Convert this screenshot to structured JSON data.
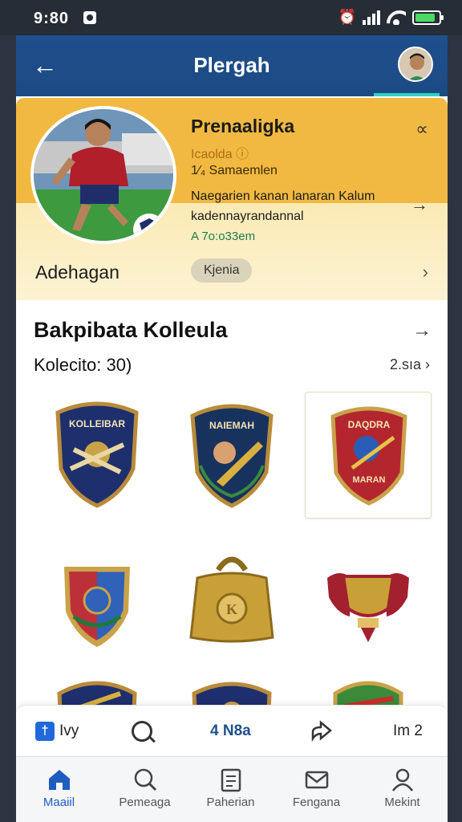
{
  "status_bar": {
    "time": "9:80",
    "battery_level": 0.85
  },
  "header": {
    "title": "Plergah",
    "back_icon": "arrow-left-icon",
    "avatar_icon": "user-avatar-icon"
  },
  "profile": {
    "name": "Prenaaligka",
    "club": "Icaolda ⓘ",
    "rank": "1⁄₄ Samaemlen",
    "description": "Naegarien kanan lanaran Kalum kadennayrandannal",
    "points": "A 7o:o33em",
    "label": "Adehagan",
    "chip": "Kjenia"
  },
  "collection": {
    "title": "Bakpibata Kolleula",
    "count": "Kolecito: 30)",
    "more": "2.sıa"
  },
  "badges": [
    {
      "type": "shield",
      "top_text": "KOLLEIBAR",
      "bottom_text": "",
      "colors": {
        "base": "#1e2f6e",
        "rim": "#b98b3a",
        "emblem": "#c9a24a"
      }
    },
    {
      "type": "shield",
      "top_text": "NAIEMAH",
      "bottom_text": "",
      "colors": {
        "base": "#18325e",
        "rim": "#b98b3a",
        "emblem": "#d9b040"
      }
    },
    {
      "type": "shield",
      "top_text": "DAQDRA",
      "bottom_text": "MARAN",
      "colors": {
        "base": "#b4262e",
        "rim": "#c9a24a",
        "emblem": "#2a5db8"
      }
    },
    {
      "type": "crest",
      "top_text": "",
      "bottom_text": "",
      "colors": {
        "base": "#2f62b8",
        "rim": "#c9a24a",
        "emblem": "#cc2b2b"
      }
    },
    {
      "type": "bag",
      "top_text": "",
      "bottom_text": "",
      "colors": {
        "base": "#c9a037",
        "rim": "#8a6a1c",
        "emblem": "#e2c065"
      }
    },
    {
      "type": "trophy",
      "top_text": "",
      "bottom_text": "",
      "colors": {
        "base": "#c9a037",
        "rim": "#a3202f",
        "emblem": "#e2c065"
      }
    }
  ],
  "actions": [
    {
      "icon": "calendar-icon",
      "label": "Ivy"
    },
    {
      "icon": "search-icon",
      "label": ""
    },
    {
      "icon": "",
      "label": "4 N8a"
    },
    {
      "icon": "share-icon",
      "label": ""
    },
    {
      "icon": "",
      "label": "Im 2"
    }
  ],
  "tabs": [
    {
      "icon": "home-icon",
      "label": "Maaiil",
      "active": true
    },
    {
      "icon": "search-icon",
      "label": "Pemeaga",
      "active": false
    },
    {
      "icon": "clipboard-icon",
      "label": "Paherian",
      "active": false
    },
    {
      "icon": "mail-icon",
      "label": "Fengana",
      "active": false
    },
    {
      "icon": "profile-icon",
      "label": "Mekint",
      "active": false
    }
  ]
}
